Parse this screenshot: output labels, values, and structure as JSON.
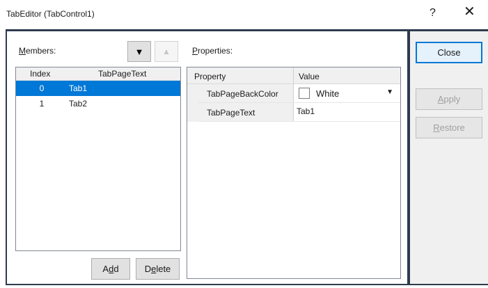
{
  "window": {
    "title": "TabEditor (TabControl1)",
    "help_glyph": "?",
    "close_glyph": "✕"
  },
  "members": {
    "label_first": "M",
    "label_rest": "embers:",
    "down_icon": "▼",
    "up_icon": "▲",
    "columns": {
      "index": "Index",
      "text": "TabPageText"
    },
    "rows": [
      {
        "index": "0",
        "text": "Tab1",
        "selected": true
      },
      {
        "index": "1",
        "text": "Tab2",
        "selected": false
      }
    ],
    "add_pre": "A",
    "add_u": "d",
    "add_post": "d",
    "delete_pre": "D",
    "delete_u": "e",
    "delete_post": "lete"
  },
  "properties": {
    "label_first": "P",
    "label_rest": "roperties:",
    "columns": {
      "property": "Property",
      "value": "Value"
    },
    "rows": [
      {
        "name": "TabPageBackColor",
        "value": "White",
        "swatch": "#ffffff"
      },
      {
        "name": "TabPageText",
        "value": "Tab1"
      }
    ]
  },
  "actions": {
    "close": "Close",
    "apply_u": "A",
    "apply_rest": "pply",
    "restore_u": "R",
    "restore_rest": "estore"
  },
  "colors": {
    "selection": "#0078d7",
    "frame": "#2e3b4e"
  }
}
